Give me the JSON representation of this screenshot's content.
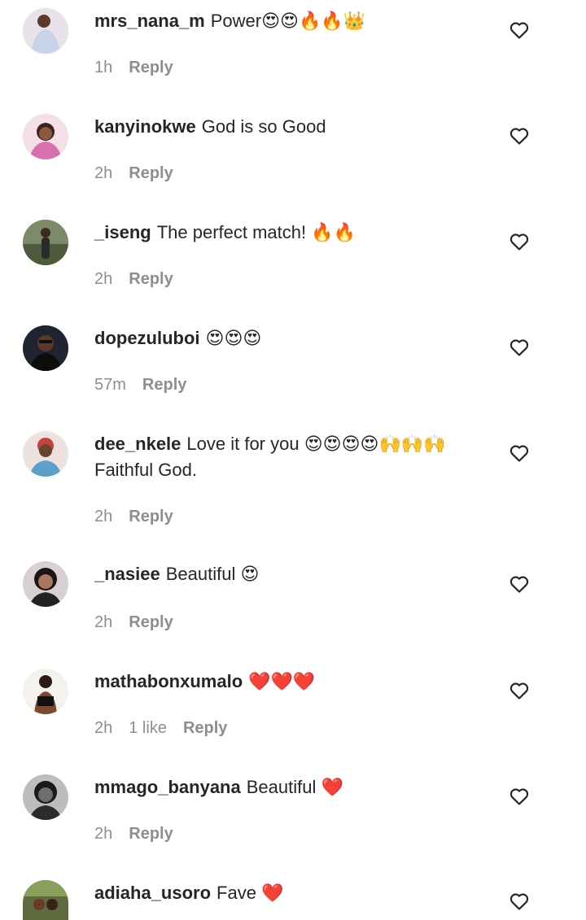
{
  "comments": [
    {
      "username": "mrs_nana_m",
      "text": "Power😍😍🔥🔥👑",
      "time": "1h",
      "likes": "",
      "reply": "Reply"
    },
    {
      "username": "kanyinokwe",
      "text": "God is so Good",
      "time": "2h",
      "likes": "",
      "reply": "Reply"
    },
    {
      "username": "_iseng",
      "text": "The perfect match! 🔥🔥",
      "time": "2h",
      "likes": "",
      "reply": "Reply"
    },
    {
      "username": "dopezuluboi",
      "text": "😍😍😍",
      "time": "57m",
      "likes": "",
      "reply": "Reply"
    },
    {
      "username": "dee_nkele",
      "text": "Love it for you 😍😍😍😍🙌🙌🙌",
      "text2": "Faithful God.",
      "time": "2h",
      "likes": "",
      "reply": "Reply"
    },
    {
      "username": "_nasiee",
      "text": "Beautiful 😍",
      "time": "2h",
      "likes": "",
      "reply": "Reply"
    },
    {
      "username": "mathabonxumalo",
      "text": "❤️❤️❤️",
      "time": "2h",
      "likes": "1 like",
      "reply": "Reply"
    },
    {
      "username": "mmago_banyana",
      "text": "Beautiful ❤️",
      "time": "2h",
      "likes": "",
      "reply": "Reply"
    },
    {
      "username": "adiaha_usoro",
      "text": "Fave ❤️",
      "time": "",
      "likes": "",
      "reply": ""
    }
  ],
  "icons": {
    "like": "heart-outline-icon"
  },
  "colors": {
    "text": "#262626",
    "meta": "#8e8e8e",
    "background": "#ffffff"
  }
}
